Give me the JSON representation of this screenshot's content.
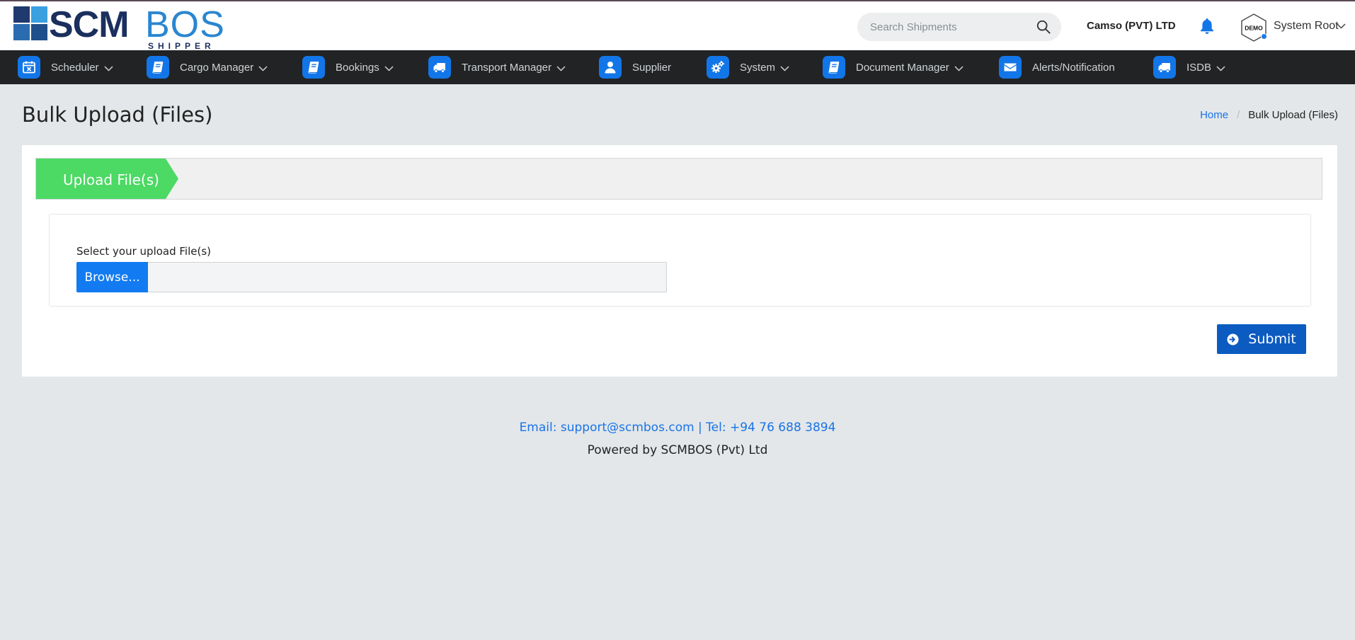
{
  "header": {
    "logo_scm": "SCM",
    "logo_bos": "BOS",
    "logo_sub": "SHIPPER",
    "search_placeholder": "Search Shipments",
    "company": "Camso (PVT) LTD",
    "avatar_text": "DEMO",
    "user_name": "System Root"
  },
  "nav": {
    "items": [
      {
        "label": "Scheduler",
        "icon": "calendar-icon",
        "has_dropdown": true
      },
      {
        "label": "Cargo Manager",
        "icon": "book-icon",
        "has_dropdown": true
      },
      {
        "label": "Bookings",
        "icon": "book-icon",
        "has_dropdown": true
      },
      {
        "label": "Transport Manager",
        "icon": "truck-icon",
        "has_dropdown": true
      },
      {
        "label": "Supplier",
        "icon": "user-icon",
        "has_dropdown": false
      },
      {
        "label": "System",
        "icon": "gears-icon",
        "has_dropdown": true
      },
      {
        "label": "Document Manager",
        "icon": "book-icon",
        "has_dropdown": true
      },
      {
        "label": "Alerts/Notification",
        "icon": "envelope-icon",
        "has_dropdown": false
      },
      {
        "label": "ISDB",
        "icon": "truck-icon",
        "has_dropdown": true
      }
    ]
  },
  "page": {
    "title": "Bulk Upload (Files)",
    "breadcrumb_home": "Home",
    "breadcrumb_sep": "/",
    "breadcrumb_current": "Bulk Upload (Files)"
  },
  "upload": {
    "step_label": "Upload File(s)",
    "field_label": "Select your upload File(s)",
    "browse_label": "Browse...",
    "file_value": "",
    "submit_label": "Submit"
  },
  "footer": {
    "contact": "Email: support@scmbos.com | Tel: +94 76 688 3894",
    "powered": "Powered by SCMBOS (Pvt) Ltd"
  },
  "colors": {
    "nav_bg": "#222324",
    "accent_blue": "#1276e8",
    "step_green": "#4cd964",
    "submit_blue": "#0b5bc1",
    "page_bg": "#e3e7e9"
  }
}
